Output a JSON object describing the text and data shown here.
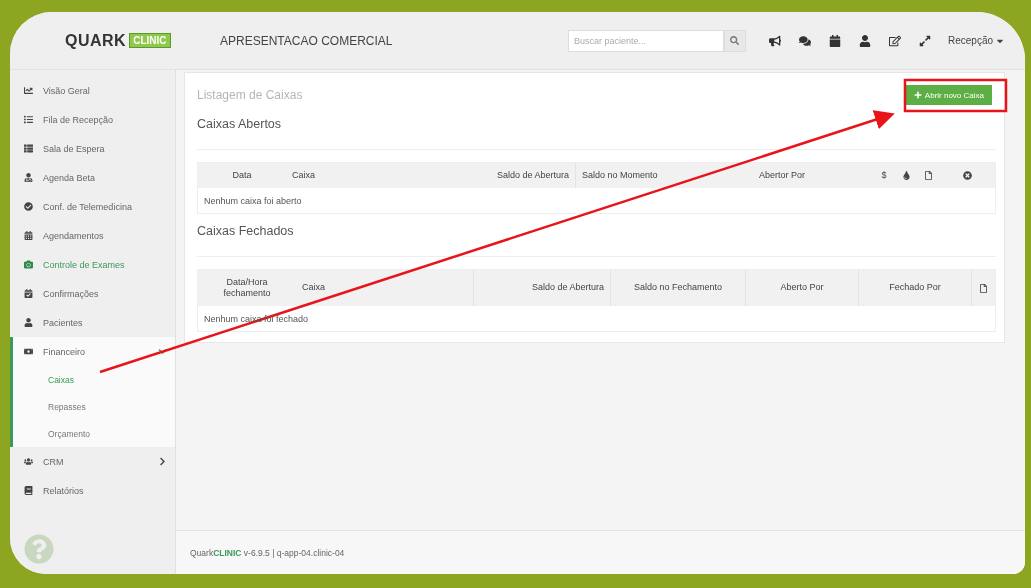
{
  "header": {
    "logo": {
      "name": "QUARK",
      "badge": "CLINIC"
    },
    "title": "APRESENTACAO COMERCIAL",
    "search": {
      "placeholder": "Buscar paciente..."
    },
    "user_menu": "Recepção"
  },
  "sidebar": {
    "items": [
      {
        "label": "Visão Geral",
        "highlighted": false
      },
      {
        "label": "Fila de Recepção",
        "highlighted": false
      },
      {
        "label": "Sala de Espera",
        "highlighted": false
      },
      {
        "label": "Agenda Beta",
        "highlighted": false
      },
      {
        "label": "Conf. de Telemedicina",
        "highlighted": false
      },
      {
        "label": "Agendamentos",
        "highlighted": false
      },
      {
        "label": "Controle de Exames",
        "highlighted": true
      },
      {
        "label": "Confirmações",
        "highlighted": false
      },
      {
        "label": "Pacientes",
        "highlighted": false
      },
      {
        "label": "Financeiro",
        "highlighted": false,
        "expanded": true,
        "children": [
          {
            "label": "Caixas",
            "selected": true
          },
          {
            "label": "Repasses",
            "selected": false
          },
          {
            "label": "Orçamento",
            "selected": false
          }
        ]
      },
      {
        "label": "CRM",
        "highlighted": false,
        "expanded": false
      },
      {
        "label": "Relatórios",
        "highlighted": false
      }
    ]
  },
  "panel": {
    "title": "Listagem de Caixas",
    "new_button": "Abrir novo Caixa",
    "sections": [
      {
        "title": "Caixas Abertos",
        "columns": [
          {
            "kind": "text",
            "label": "Data"
          },
          {
            "kind": "text",
            "label": "Caixa"
          },
          {
            "kind": "text",
            "label": "Saldo de Abertura"
          },
          {
            "kind": "text",
            "label": "Saldo no Momento"
          },
          {
            "kind": "text",
            "label": "Abertor Por"
          },
          {
            "kind": "text",
            "label": "$"
          },
          {
            "kind": "icon"
          },
          {
            "kind": "icon"
          },
          {
            "kind": "icon"
          }
        ],
        "empty_message": "Nenhum caixa foi aberto"
      },
      {
        "title": "Caixas Fechados",
        "columns": [
          {
            "kind": "text",
            "label": "Data/Hora fechamento"
          },
          {
            "kind": "text",
            "label": "Caixa"
          },
          {
            "kind": "text",
            "label": "Saldo de Abertura"
          },
          {
            "kind": "text",
            "label": "Saldo no Fechamento"
          },
          {
            "kind": "text",
            "label": "Aberto Por"
          },
          {
            "kind": "text",
            "label": "Fechado Por"
          },
          {
            "kind": "icon"
          }
        ],
        "empty_message": "Nenhum caixa foi fechado"
      }
    ]
  },
  "footer": {
    "text": "Quark**CLINIC** v-6.9.5 | q-app-04.clinic-04"
  }
}
